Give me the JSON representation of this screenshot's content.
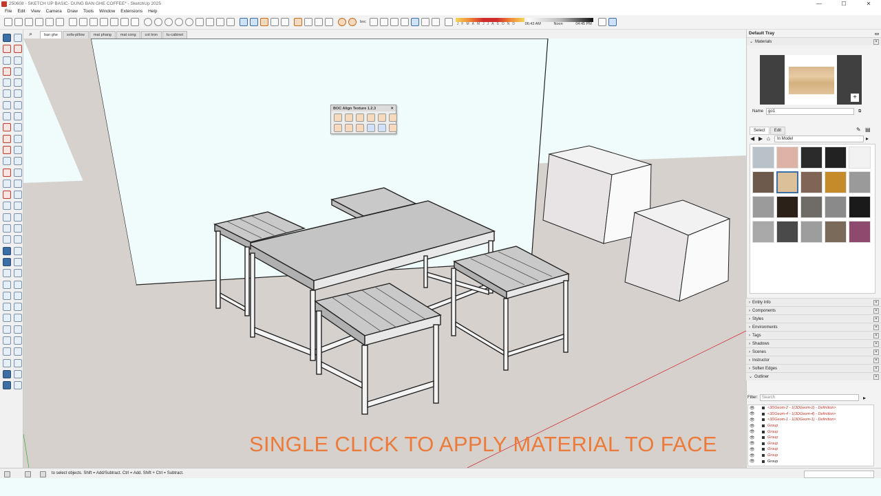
{
  "window": {
    "title": "250608 - SKETCH UP BASIC- DUNG BAN GHE COFFEE* - SketchUp 2025",
    "min": "—",
    "max": "☐",
    "close": "✕"
  },
  "menu": [
    "File",
    "Edit",
    "View",
    "Camera",
    "Draw",
    "Tools",
    "Window",
    "Extensions",
    "Help"
  ],
  "toolbar": {
    "shadow_months": [
      "J",
      "F",
      "M",
      "A",
      "M",
      "J",
      "J",
      "A",
      "S",
      "O",
      "N",
      "D"
    ],
    "time_start": "06:43 AM",
    "time_mid": "Noon",
    "time_end": "04:45 PM",
    "boc_label": "boc"
  },
  "scene_tabs": [
    "ban ghe",
    "sofa-pillow",
    "mat phang",
    "mat cong",
    "cot tron",
    "tu-cabinet"
  ],
  "active_tab": "ban ghe",
  "boc_panel": {
    "title": "BOC Align Texture 1.2.3",
    "close": "✕"
  },
  "caption": "SINGLE CLICK TO APPLY MATERIAL TO FACE",
  "tray": {
    "title": "Default Tray",
    "materials_header": "Materials",
    "name_label": "Name",
    "name_value": "go1",
    "tab_select": "Select",
    "tab_edit": "Edit",
    "collection": "In Model",
    "swatch_colors": [
      "#b9c2c9",
      "#dcb3a4",
      "#2a2a2a",
      "#222222",
      "#f2f2f2",
      "#6e5a4d",
      "#dcc09a",
      "#806455",
      "#c58a2a",
      "#9a9a9a",
      "#9b9b9b",
      "#2b2118",
      "#6f6c67",
      "#8a8a8a",
      "#1a1a1a",
      "#a8a8a8",
      "#4a4a4a",
      "#9d9d9d",
      "#7a6a5a",
      "#8e4a6e"
    ],
    "sections": [
      "Entity Info",
      "Components",
      "Styles",
      "Environments",
      "Tags",
      "Shadows",
      "Scenes",
      "Instructor",
      "Soften Edges",
      "Outliner"
    ],
    "filter_label": "Filter:",
    "filter_placeholder": "Search",
    "outliner_rows": [
      {
        "label": "<3DGeom-2 - 1(3DGeom-2) - Definition>",
        "kind": "c"
      },
      {
        "label": "<3DGeom-4 - 1(3DGeom-4) - Definition>",
        "kind": "c"
      },
      {
        "label": "<3DGeom-1 - 1(3DGeom-1) - Definition>",
        "kind": "c"
      },
      {
        "label": "Group",
        "kind": "c"
      },
      {
        "label": "Group",
        "kind": "c"
      },
      {
        "label": "Group",
        "kind": "c"
      },
      {
        "label": "Group",
        "kind": "c"
      },
      {
        "label": "Group",
        "kind": "c"
      },
      {
        "label": "Group",
        "kind": "c"
      },
      {
        "label": "Group",
        "kind": "n"
      }
    ]
  },
  "status": {
    "hint": "to select objects. Shift = Add/Subtract. Ctrl = Add. Shift + Ctrl = Subtract."
  }
}
